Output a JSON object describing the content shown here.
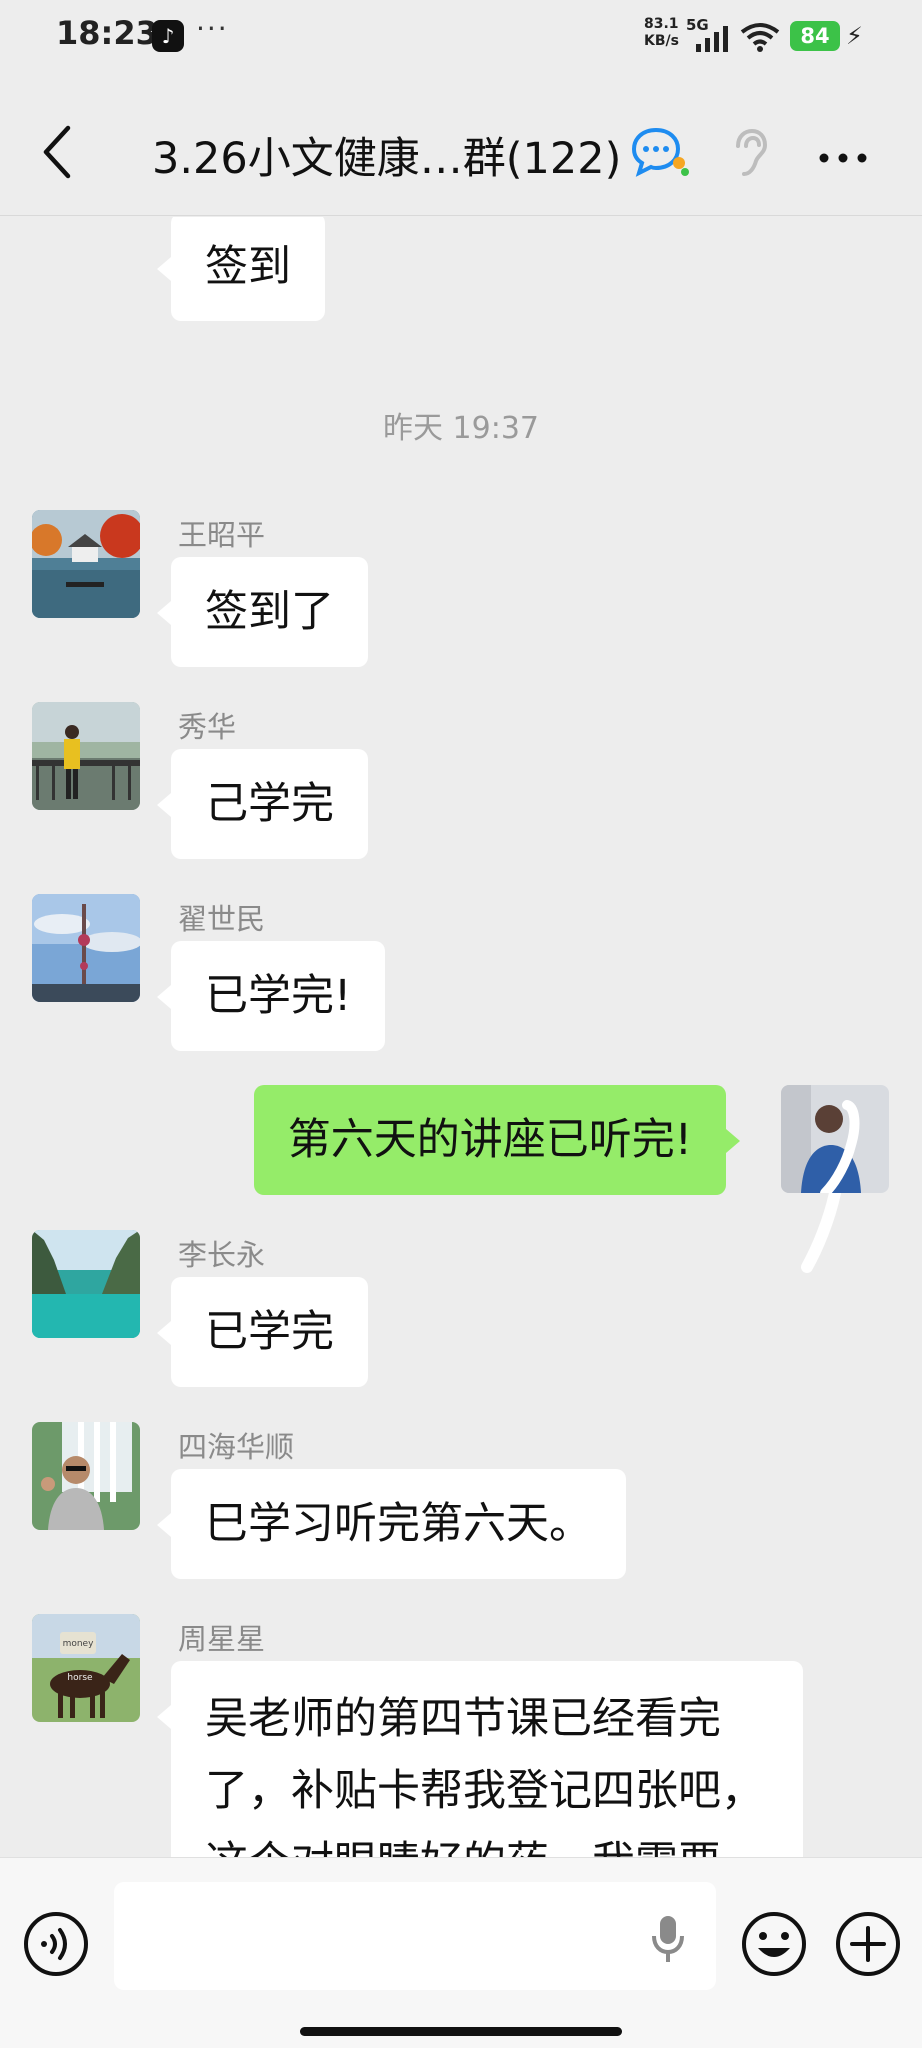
{
  "status_bar": {
    "time": "18:23",
    "app_glyph": "♪",
    "dots": "···",
    "net_speed": "83.1",
    "net_unit": "KB/s",
    "net_type": "5G",
    "battery": "84"
  },
  "header": {
    "title": "3.26小文健康…群(122)"
  },
  "chat": {
    "partial_message": "签到",
    "timestamp": "昨天 19:37",
    "messages": [
      {
        "sender": "王昭平",
        "text": "签到了"
      },
      {
        "sender": "秀华",
        "text": "己学完"
      },
      {
        "sender": "翟世民",
        "text": "已学完!"
      },
      {
        "sender": "",
        "text": "第六天的讲座已听完!",
        "mine": true
      },
      {
        "sender": "李长永",
        "text": "已学完"
      },
      {
        "sender": "四海华顺",
        "text": "巳学习听完第六天。"
      },
      {
        "sender": "周星星",
        "text": "吴老师的第四节课已经看完了，补贴卡帮我登记四张吧，这个对眼睛好的药，我需要"
      }
    ],
    "avatar_texts": {
      "money": "money",
      "horse": "horse"
    }
  },
  "colors": {
    "background": "#ededed",
    "my_bubble": "#95ec69",
    "other_bubble": "#ffffff",
    "battery": "#3cc248"
  },
  "icons": [
    "back-icon",
    "chat-bubble-icon",
    "ear-icon",
    "more-icon",
    "voice-icon",
    "mic-icon",
    "emoji-icon",
    "plus-icon"
  ]
}
